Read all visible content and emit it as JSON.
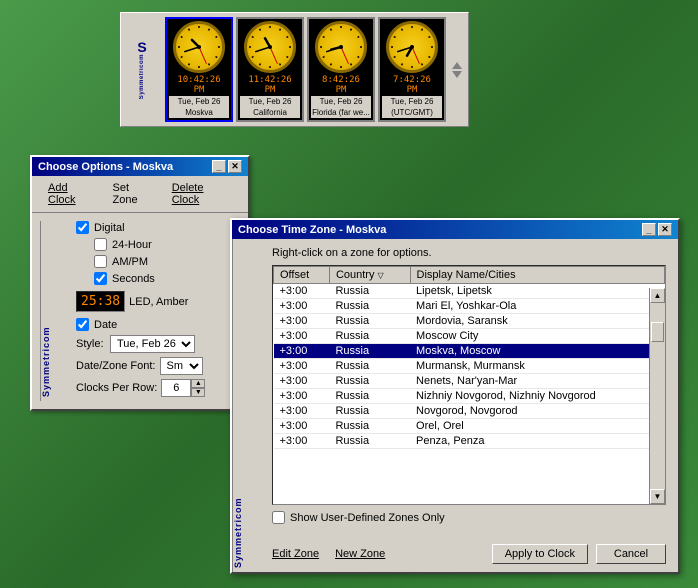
{
  "widget": {
    "logo": "S",
    "logo_text": "Symmetricom",
    "clocks": [
      {
        "time": "10:42:26 PM",
        "day": "Tue, Feb 26",
        "label": "Moskva",
        "selected": true,
        "hour_angle": 315,
        "min_angle": 252,
        "sec_angle": 156
      },
      {
        "time": "11:42:26 PM",
        "day": "Tue, Feb 26",
        "label": "California",
        "selected": false,
        "hour_angle": 330,
        "min_angle": 252,
        "sec_angle": 156
      },
      {
        "time": "8:42:26 PM",
        "day": "Tue, Feb 26",
        "label": "Florida (far we...",
        "selected": false,
        "hour_angle": 255,
        "min_angle": 252,
        "sec_angle": 156
      },
      {
        "time": "7:42:26 PM",
        "day": "Tue, Feb 26",
        "label": "(UTC/GMT)",
        "selected": false,
        "hour_angle": 210,
        "min_angle": 252,
        "sec_angle": 156
      }
    ]
  },
  "options_window": {
    "title": "Choose Options - Moskva",
    "menu": {
      "add_clock": "Add Clock",
      "set_zone": "Set Zone",
      "delete_clock": "Delete Clock"
    },
    "digital_label": "Digital",
    "digital_checked": true,
    "hour24_label": "24-Hour",
    "hour24_checked": false,
    "ampm_label": "AM/PM",
    "ampm_checked": false,
    "seconds_label": "Seconds",
    "seconds_checked": true,
    "led_time": "25:38",
    "led_type": "LED, Amber",
    "date_label": "Date",
    "date_checked": true,
    "style_label": "Style:",
    "style_value": "Tue, Feb 26",
    "font_label": "Date/Zone Font:",
    "font_value": "Sm",
    "clocks_row_label": "Clocks Per Row:",
    "clocks_row_value": "6"
  },
  "timezone_window": {
    "title": "Choose Time Zone - Moskva",
    "instruction": "Right-click on a zone for options.",
    "columns": {
      "offset": "Offset",
      "country": "Country",
      "country_sort": "▽",
      "display": "Display Name/Cities"
    },
    "rows": [
      {
        "offset": "+3:00",
        "country": "Russia",
        "display": "Lipetsk, Lipetsk",
        "selected": false
      },
      {
        "offset": "+3:00",
        "country": "Russia",
        "display": "Mari El, Yoshkar-Ola",
        "selected": false
      },
      {
        "offset": "+3:00",
        "country": "Russia",
        "display": "Mordovia, Saransk",
        "selected": false
      },
      {
        "offset": "+3:00",
        "country": "Russia",
        "display": "Moscow City",
        "selected": false
      },
      {
        "offset": "+3:00",
        "country": "Russia",
        "display": "Moskva, Moscow",
        "selected": true
      },
      {
        "offset": "+3:00",
        "country": "Russia",
        "display": "Murmansk, Murmansk",
        "selected": false
      },
      {
        "offset": "+3:00",
        "country": "Russia",
        "display": "Nenets, Nar'yan-Mar",
        "selected": false
      },
      {
        "offset": "+3:00",
        "country": "Russia",
        "display": "Nizhniy Novgorod, Nizhniy Novgorod",
        "selected": false
      },
      {
        "offset": "+3:00",
        "country": "Russia",
        "display": "Novgorod, Novgorod",
        "selected": false
      },
      {
        "offset": "+3:00",
        "country": "Russia",
        "display": "Orel, Orel",
        "selected": false
      },
      {
        "offset": "+3:00",
        "country": "Russia",
        "display": "Penza, Penza",
        "selected": false
      }
    ],
    "show_user_zones": "Show User-Defined Zones Only",
    "show_user_zones_checked": false,
    "footer": {
      "edit_zone": "Edit Zone",
      "new_zone": "New Zone",
      "apply_to_clock": "Apply to Clock",
      "cancel": "Cancel"
    }
  }
}
